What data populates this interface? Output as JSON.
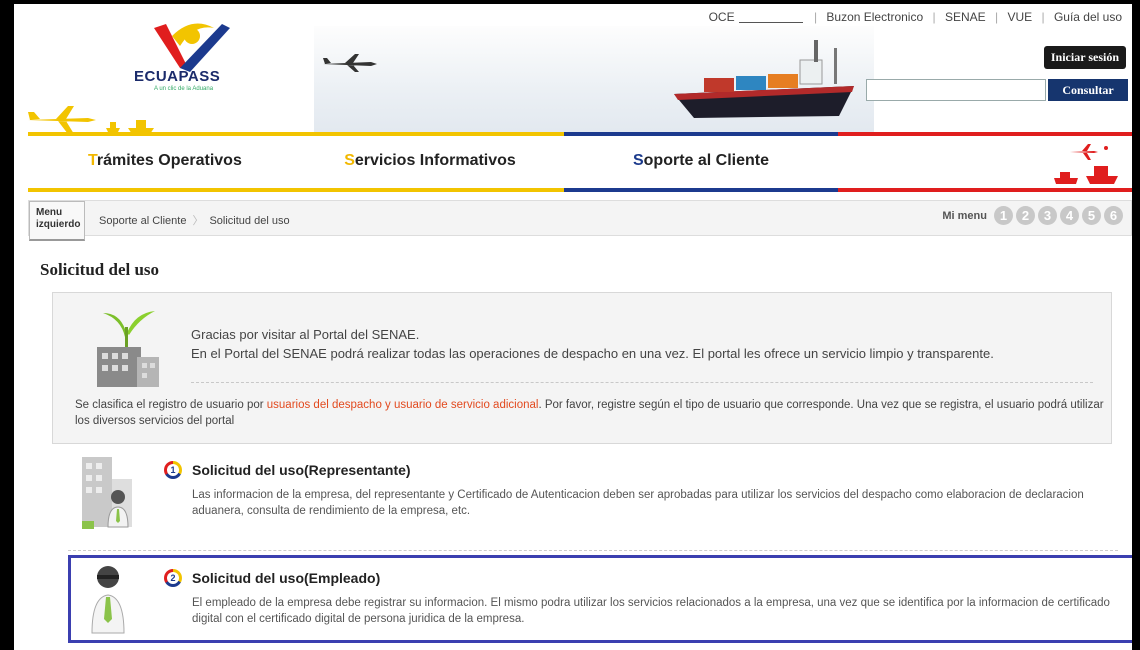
{
  "header": {
    "logo_text": "ECUAPASS",
    "logo_tagline": "A un clic de la Aduana",
    "top_links": [
      "OCE",
      "Buzon Electronico",
      "SENAE",
      "VUE",
      "Guía del uso"
    ],
    "login_label": "Iniciar sesión",
    "search_value": "",
    "search_button": "Consultar"
  },
  "menu": [
    {
      "first": "T",
      "rest": "rámites Operativos"
    },
    {
      "first": "S",
      "rest": "ervicios Informativos"
    },
    {
      "first": "S",
      "rest": "oporte al Cliente"
    }
  ],
  "breadcrumb": {
    "left_menu_line1": "Menu",
    "left_menu_line2": "izquierdo",
    "items": [
      "Soporte al Cliente",
      "Solicitud del uso"
    ],
    "mi_menu_label": "Mi menu",
    "mi_menu_numbers": [
      "1",
      "2",
      "3",
      "4",
      "5",
      "6"
    ]
  },
  "page_title": "Solicitud del uso",
  "intro": {
    "line1": "Gracias por visitar al Portal del SENAE.",
    "line2": "En el Portal del SENAE podrá realizar todas las operaciones de despacho en una vez. El portal les ofrece un servicio limpio y transparente.",
    "note_before": "Se clasifica el registro de usuario por ",
    "note_highlight": "usuarios del despacho y usuario de servicio adicional",
    "note_after": ". Por favor, registre según el tipo de usuario que corresponde. Una vez que se registra, el usuario podrá utilizar los diversos servicios del portal"
  },
  "options": [
    {
      "badge": "1",
      "title": "Solicitud del uso(Representante)",
      "desc": "Las informacion de la empresa, del representante y Certificado de Autenticacion deben ser aprobadas para utilizar los servicios del despacho como elaboracion de declaracion aduanera, consulta de rendimiento de la empresa, etc."
    },
    {
      "badge": "2",
      "title": "Solicitud del uso(Empleado)",
      "desc": "El empleado de la empresa debe registrar su informacion. El mismo podra utilizar los servicios relacionados a la empresa, una vez que se identifica por la informacion de certificado digital con el certificado digital de persona juridica de la empresa."
    }
  ],
  "colors": {
    "yellow": "#f2c400",
    "blue": "#1c3a8e",
    "red": "#e01e1e",
    "highlight_border": "#3b3fb0"
  }
}
